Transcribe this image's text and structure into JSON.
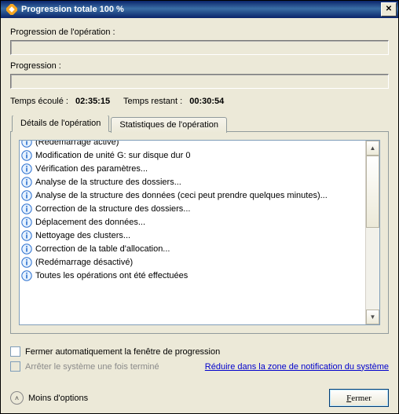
{
  "titlebar": {
    "title": "Progression totale 100 %"
  },
  "labels": {
    "op_progress": "Progression de l'opération :",
    "progress": "Progression :",
    "elapsed": "Temps écoulé :",
    "remaining": "Temps restant :"
  },
  "times": {
    "elapsed": "02:35:15",
    "remaining": "00:30:54"
  },
  "tabs": {
    "details": "Détails de l'opération",
    "stats": "Statistiques de l'opération"
  },
  "details_list": [
    "(Redémarrage activé)",
    "Modification de unité G: sur disque dur  0",
    "Vérification des paramètres...",
    "Analyse de la structure des dossiers...",
    "Analyse de la structure des données (ceci peut prendre quelques minutes)...",
    "Correction de la structure des dossiers...",
    "Déplacement des données...",
    "Nettoyage des clusters...",
    "Correction de la table d'allocation...",
    "(Redémarrage désactivé)",
    "Toutes les opérations ont été effectuées"
  ],
  "checks": {
    "auto_close": "Fermer automatiquement la fenêtre de progression",
    "shutdown": "Arrêter le système une fois terminé"
  },
  "link": "Réduire dans la zone de notification du système",
  "less_options": "Moins d'options",
  "close_btn_pre": "F",
  "close_btn_post": "ermer"
}
